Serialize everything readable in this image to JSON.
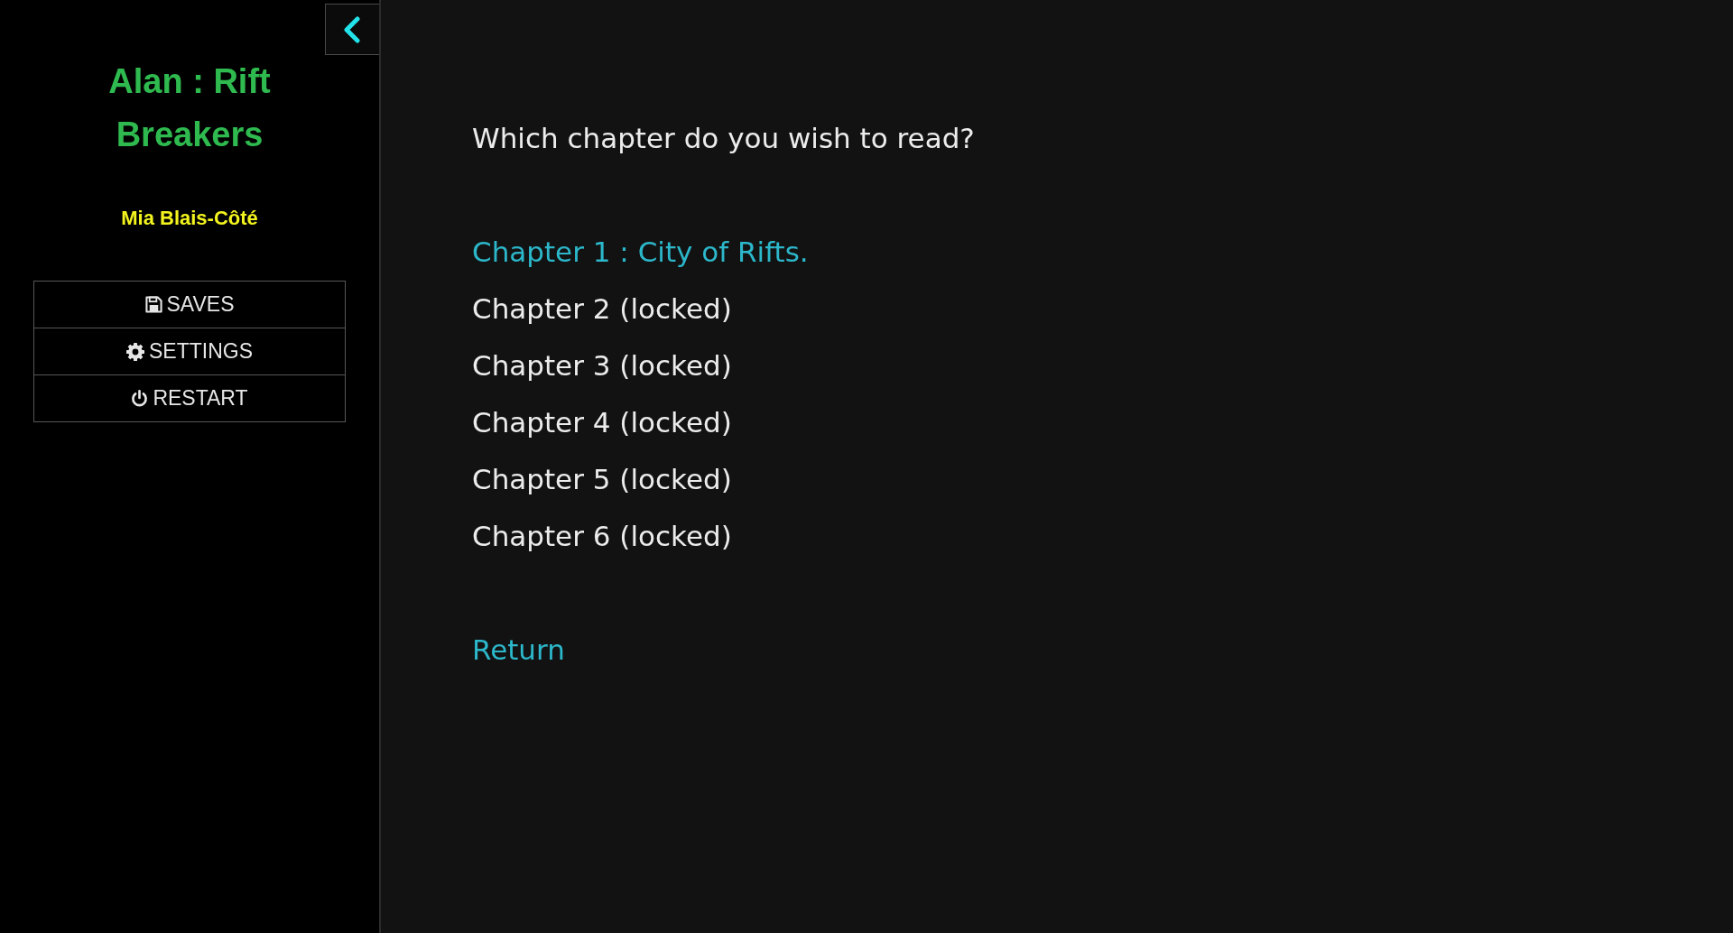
{
  "sidebar": {
    "title": "Alan : Rift Breakers",
    "author": "Mia Blais-Côté",
    "menu": [
      {
        "kind": "saves",
        "label": "SAVES"
      },
      {
        "kind": "settings",
        "label": "SETTINGS"
      },
      {
        "kind": "restart",
        "label": "RESTART"
      }
    ]
  },
  "main": {
    "prompt": "Which chapter do you wish to read?",
    "chapters": [
      {
        "label": "Chapter 1 : City of Rifts.",
        "locked": false
      },
      {
        "label": "Chapter 2 (locked)",
        "locked": true
      },
      {
        "label": "Chapter 3 (locked)",
        "locked": true
      },
      {
        "label": "Chapter 4 (locked)",
        "locked": true
      },
      {
        "label": "Chapter 5 (locked)",
        "locked": true
      },
      {
        "label": "Chapter 6 (locked)",
        "locked": true
      }
    ],
    "return_link": "Return"
  }
}
